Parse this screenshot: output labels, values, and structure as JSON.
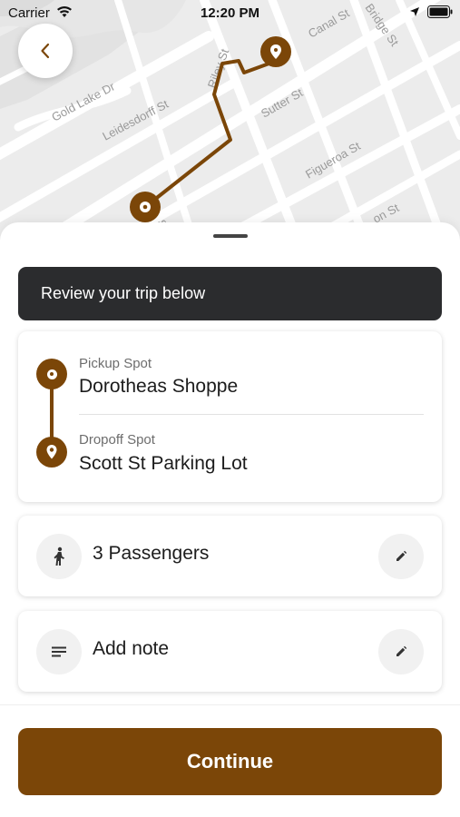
{
  "status_bar": {
    "carrier": "Carrier",
    "time": "12:20 PM"
  },
  "map": {
    "street_labels": [
      "Gold Lake Dr",
      "Leidesdorff St",
      "Riley St",
      "Canal St",
      "Sutter St",
      "Figueroa St",
      "Bridge St",
      "on St",
      "St"
    ],
    "route_color": "#7b4608"
  },
  "back_button": {
    "icon": "chevron-left-icon"
  },
  "banner": {
    "text": "Review your trip below"
  },
  "trip": {
    "pickup_caption": "Pickup Spot",
    "pickup_name": "Dorotheas Shoppe",
    "dropoff_caption": "Dropoff Spot",
    "dropoff_name": "Scott St Parking Lot"
  },
  "options": {
    "passengers_label": "3 Passengers",
    "passengers_icon": "person-walking-icon",
    "note_label": "Add note",
    "note_icon": "notes-icon",
    "edit_icon": "pencil-icon"
  },
  "continue_label": "Continue",
  "colors": {
    "brand": "#7b4608",
    "banner_bg": "#2b2c2e"
  }
}
